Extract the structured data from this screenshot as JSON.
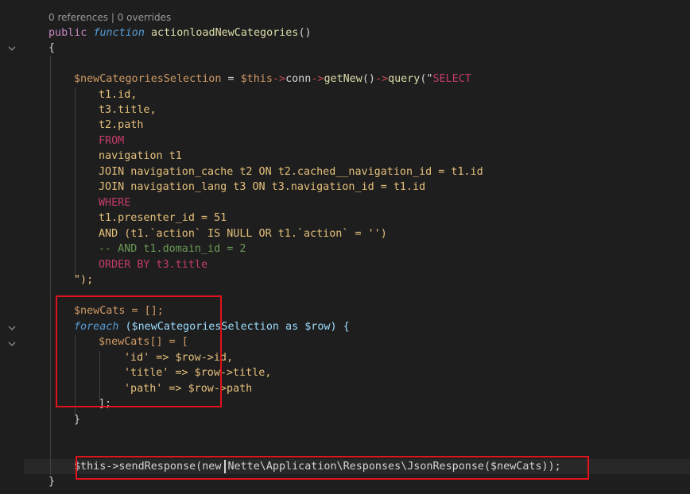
{
  "codelens": "0 references | 0 overrides",
  "tokens": {
    "public": "public",
    "function": "function",
    "method_name": "actionloadNewCategories",
    "parens": "()",
    "open_brace": "{",
    "close_brace": "}",
    "var_selection": "$newCategoriesSelection",
    "assign": " = ",
    "this": "$this",
    "arrow": "->",
    "conn": "conn",
    "getNew": "getNew",
    "query": "query",
    "query_open": "(\"",
    "select": "SELECT",
    "sql_lines": [
      "t1.id,",
      "t3.title,",
      "t2.path",
      "FROM",
      "navigation t1",
      "JOIN navigation_cache t2 ON t2.cached__navigation_id = t1.id",
      "JOIN navigation_lang t3 ON t3.navigation_id = t1.id",
      "WHERE",
      "t1.presenter_id = 51",
      "AND (t1.`action` IS NULL OR t1.`action` = '')",
      "-- AND t1.domain_id = 2",
      "ORDER BY t3.title"
    ],
    "query_close": "\");",
    "newcats_decl": "$newCats = [];",
    "foreach": "foreach",
    "foreach_expr": "($newCategoriesSelection as $row) {",
    "newcats_push": "$newCats[] = [",
    "arr_id": "'id' => $row->id,",
    "arr_title": "'title' => $row->title,",
    "arr_path": "'path' => $row->path",
    "arr_close": "];",
    "send_line": "$this->sendResponse(new Nette\\Application\\Responses\\JsonResponse($newCats));"
  }
}
